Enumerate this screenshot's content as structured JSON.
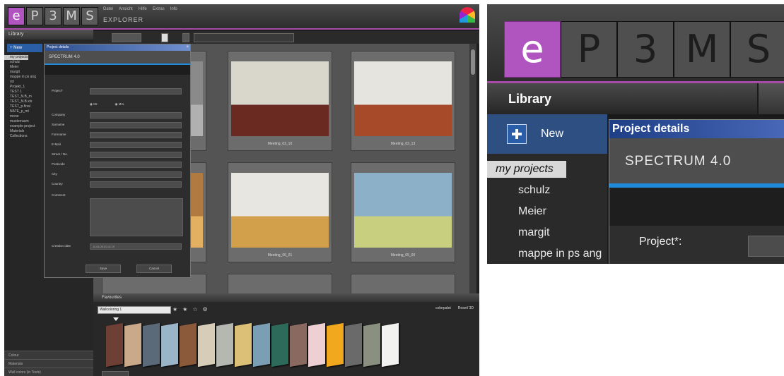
{
  "app": {
    "logo_letters": [
      "e",
      "P",
      "3",
      "M",
      "S"
    ],
    "app_name": "EXPLORER",
    "menu": [
      "Datei",
      "Ansicht",
      "Hilfe",
      "Extras",
      "Info"
    ],
    "sidebar": {
      "header": "Library",
      "new_label": "New",
      "items": [
        "my projects",
        "schulz",
        "Meier",
        "margit",
        "mappe in ps ang",
        "rot",
        "Projekt_1",
        "TEST 1",
        "TEST_N.B_m",
        "TEST_N.B.xls",
        "TEST_p.final",
        "NATE_p_mt",
        "mone",
        "musterraum",
        "example project",
        "Materials",
        "Collections"
      ],
      "footer": [
        "Colour",
        "Materials",
        "Wall colors (in Tools)"
      ]
    },
    "gallery": {
      "thumbnails": [
        {
          "caption": "",
          "colors": [
            "#8a8a8a",
            "#b0b0b0"
          ]
        },
        {
          "caption": "Meeting_03_10",
          "colors": [
            "#d9d6cc",
            "#6a2a22"
          ]
        },
        {
          "caption": "Meeting_03_13",
          "colors": [
            "#e6e4de",
            "#a64a2a"
          ]
        },
        {
          "caption": "",
          "colors": [
            "#b07a40",
            "#e2b060"
          ]
        },
        {
          "caption": "Meeting_06_01",
          "colors": [
            "#e8e6e0",
            "#d2a04a"
          ]
        },
        {
          "caption": "Meeting_05_00",
          "colors": [
            "#8cb0c8",
            "#c8d080"
          ]
        }
      ]
    },
    "dialog": {
      "title": "Project details",
      "brand": "SPECTRUM 4.0",
      "fields": [
        "Project*",
        "Company",
        "Surname",
        "Forename",
        "E-Mail",
        "Street / No.",
        "Postcode",
        "City",
        "Country",
        "Comment",
        "Creation date"
      ],
      "radio_labels": [
        "Mr.",
        "Mrs."
      ],
      "creation_date_value": "11.06.2013 14:13",
      "save_label": "Save",
      "cancel_label": "Cancel"
    },
    "favourites": {
      "header": "Favourites",
      "select_value": "Wallcoloring 1",
      "tools": [
        "colorpalet",
        "Reset/ 3D"
      ],
      "swatches": [
        "#6e4035",
        "#caa88a",
        "#5a6a78",
        "#9ab4c8",
        "#8a5a3a",
        "#d6ccb8",
        "#b4b8b0",
        "#dcc078",
        "#7a9eb4",
        "#2e6a5a",
        "#8a6a60",
        "#eed0d4",
        "#f2a81e",
        "#6a6a6a",
        "#8a9080",
        "#f2f2f0"
      ]
    }
  },
  "zoom": {
    "logo_letters": [
      "e",
      "P",
      "3",
      "M",
      "S"
    ],
    "library_header": "Library",
    "new_label": "New",
    "projects": [
      "my projects",
      "schulz",
      "Meier",
      "margit",
      "mappe in ps ang"
    ],
    "dialog_title": "Project details",
    "brand": "SPECTRUM 4.0",
    "project_label": "Project*:"
  }
}
